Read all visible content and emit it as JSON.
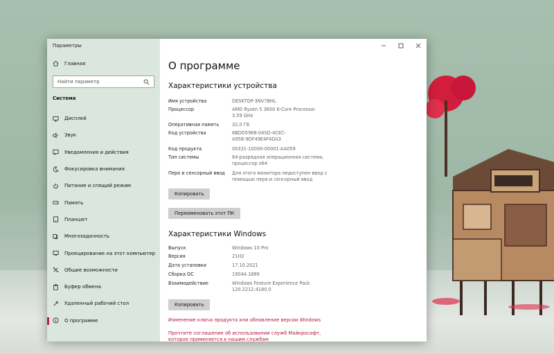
{
  "window": {
    "title": "Параметры"
  },
  "sidebar": {
    "home_label": "Главная",
    "search_placeholder": "Найти параметр",
    "section_title": "Система",
    "items": [
      {
        "label": "Дисплей",
        "icon": "monitor-icon"
      },
      {
        "label": "Звук",
        "icon": "speaker-icon"
      },
      {
        "label": "Уведомления и действия",
        "icon": "notifications-icon"
      },
      {
        "label": "Фокусировка внимания",
        "icon": "moon-icon"
      },
      {
        "label": "Питание и спящий режим",
        "icon": "power-icon"
      },
      {
        "label": "Память",
        "icon": "storage-icon"
      },
      {
        "label": "Планшет",
        "icon": "tablet-icon"
      },
      {
        "label": "Многозадачность",
        "icon": "multitasking-icon"
      },
      {
        "label": "Проецирование на этот компьютер",
        "icon": "projecting-icon"
      },
      {
        "label": "Общие возможности",
        "icon": "shared-experiences-icon"
      },
      {
        "label": "Буфер обмена",
        "icon": "clipboard-icon"
      },
      {
        "label": "Удаленный рабочий стол",
        "icon": "remote-desktop-icon"
      },
      {
        "label": "О программе",
        "icon": "info-icon",
        "active": true
      }
    ]
  },
  "content": {
    "title": "О программе",
    "device_heading": "Характеристики устройства",
    "device_specs": [
      {
        "key": "Имя устройства",
        "value": "DESKTOP-3NV7BHL"
      },
      {
        "key": "Процессор",
        "value": "AMD Ryzen 5 3600 6-Core Processor\n3.59 GHz"
      },
      {
        "key": "Оперативная память",
        "value": "32,0 ГБ"
      },
      {
        "key": "Код устройства",
        "value": "8BDD5968-04SD-4CEC-\nA958-9DF49E4F4DA3"
      },
      {
        "key": "Код продукта",
        "value": "00331-10000-00001-AA059"
      },
      {
        "key": "Тип системы",
        "value": "64-разрядная операционная система,\nпроцессор x64"
      },
      {
        "key": "Перо и сенсорный ввод",
        "value": "Для этого монитора недоступен ввод с\nпомощью пера и сенсорный ввод"
      }
    ],
    "copy_button": "Копировать",
    "rename_button": "Переименовать этот ПК",
    "windows_heading": "Характеристики Windows",
    "windows_specs": [
      {
        "key": "Выпуск",
        "value": "Windows 10 Pro"
      },
      {
        "key": "Версия",
        "value": "21H2"
      },
      {
        "key": "Дата установки",
        "value": "17.10.2021"
      },
      {
        "key": "Сборка ОС",
        "value": "19044.1889"
      },
      {
        "key": "Взаимодействие",
        "value": "Windows Feature Experience Pack\n120.2212.4180.0"
      }
    ],
    "copy_button_2": "Копировать",
    "link_product_key": "Изменение ключа продукта или обновление версии Windows",
    "link_agreement": "Прочтите соглашение об использовании служб Майкрософт,\nкоторое применяется к нашим службам"
  },
  "colors": {
    "accent": "#c01c3a",
    "link": "#b3163c",
    "sidebar_bg": "#dbe6df"
  }
}
